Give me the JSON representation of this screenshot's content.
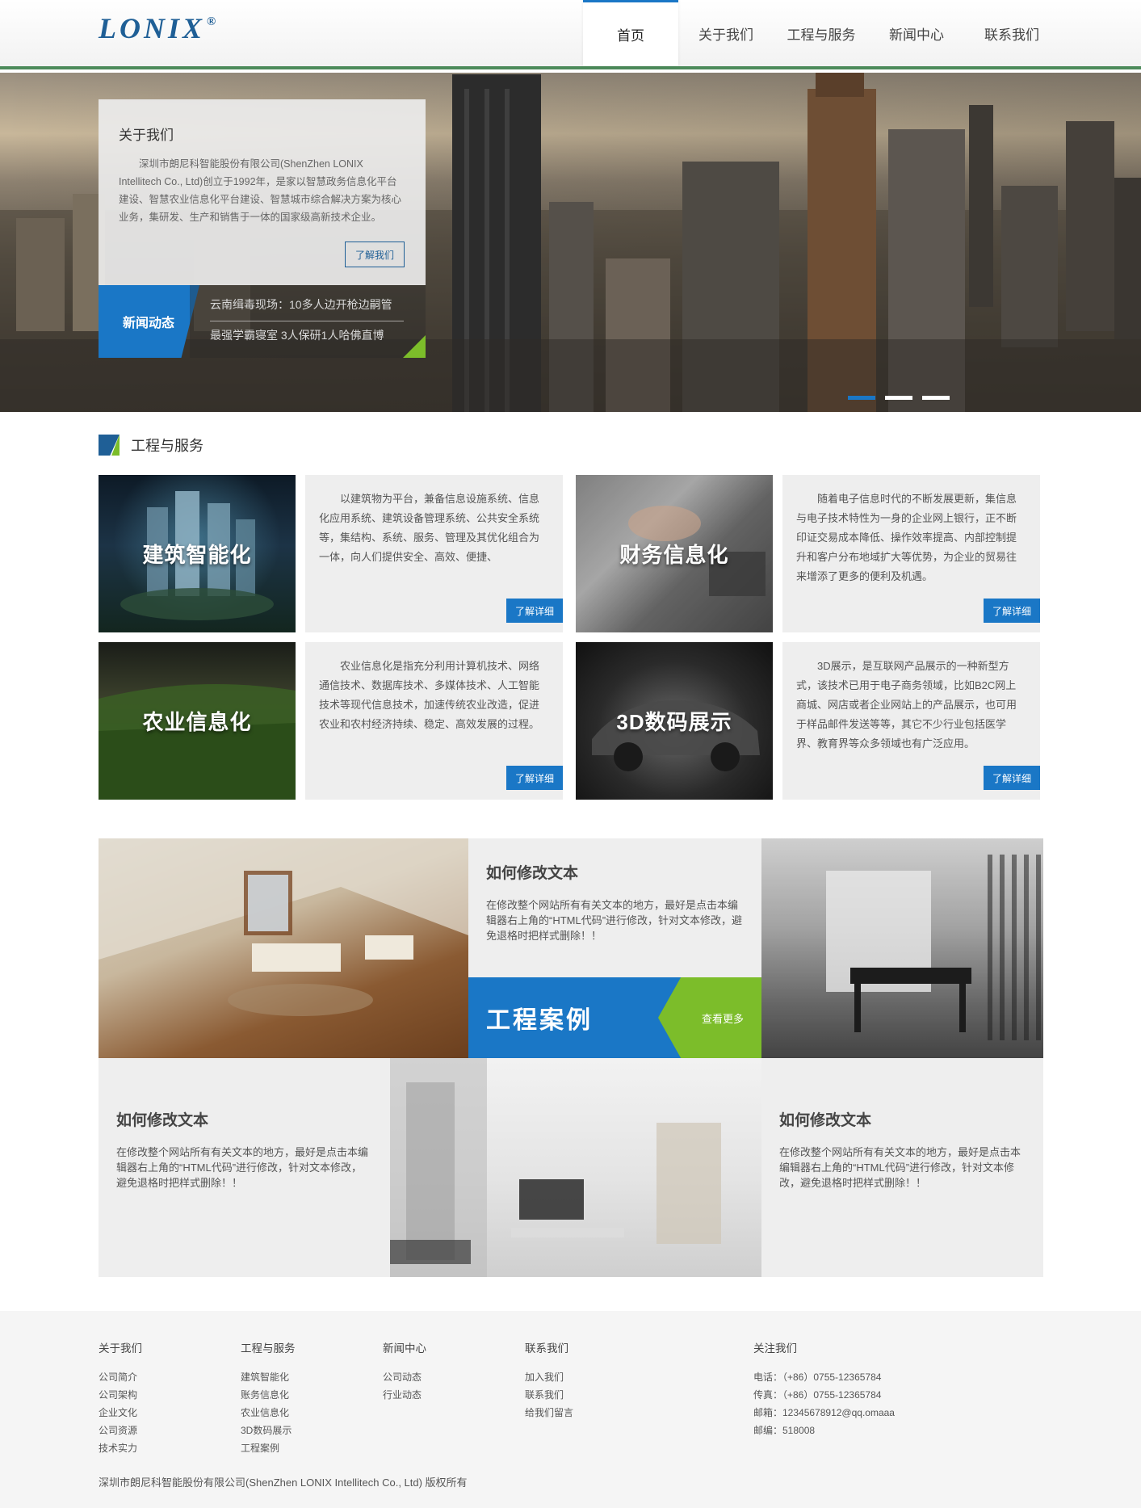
{
  "logo": {
    "text": "LONIX",
    "mark": "®"
  },
  "nav": {
    "items": [
      {
        "label": "首页",
        "active": true
      },
      {
        "label": "关于我们",
        "active": false
      },
      {
        "label": "工程与服务",
        "active": false
      },
      {
        "label": "新闻中心",
        "active": false
      },
      {
        "label": "联系我们",
        "active": false
      }
    ]
  },
  "hero": {
    "about": {
      "title": "关于我们",
      "text": "深圳市朗尼科智能股份有限公司(ShenZhen LONIX Intellitech Co., Ltd)创立于1992年，是家以智慧政务信息化平台建设、智慧农业信息化平台建设、智慧城市综合解决方案为核心业务，集研发、生产和销售于一体的国家级高新技术企业。",
      "button": "了解我们"
    },
    "news": {
      "label": "新闻动态",
      "items": [
        "云南缉毒现场：10多人边开枪边嗣管",
        "最强学霸寝室 3人保研1人哈佛直博"
      ]
    },
    "slides": 3,
    "active_slide": 0
  },
  "services": {
    "title": "工程与服务",
    "items": [
      {
        "caption": "建筑智能化",
        "text": "以建筑物为平台，兼备信息设施系统、信息化应用系统、建筑设备管理系统、公共安全系统等，集结构、系统、服务、管理及其优化组合为一体，向人们提供安全、高效、便捷、",
        "button": "了解详细"
      },
      {
        "caption": "财务信息化",
        "text": "随着电子信息时代的不断发展更新，集信息与电子技术特性为一身的企业网上银行，正不断印证交易成本降低、操作效率提高、内部控制提升和客户分布地域扩大等优势，为企业的贸易往来增添了更多的便利及机遇。",
        "button": "了解详细"
      },
      {
        "caption": "农业信息化",
        "text": "农业信息化是指充分利用计算机技术、网络通信技术、数据库技术、多媒体技术、人工智能技术等现代信息技术，加速传统农业改造，促进农业和农村经济持续、稳定、高效发展的过程。",
        "button": "了解详细"
      },
      {
        "caption": "3D数码展示",
        "text": "3D展示，是互联网产品展示的一种新型方式，该技术已用于电子商务领域，比如B2C网上商城、网店或者企业网站上的产品展示，也可用于样品邮件发送等等，其它不少行业包括医学界、教育界等众多领域也有广泛应用。",
        "button": "了解详细"
      }
    ]
  },
  "cases": {
    "band_title": "工程案例",
    "more": "查看更多",
    "blocks": [
      {
        "title": "如何修改文本",
        "text": "在修改整个网站所有有关文本的地方，最好是点击本编辑器右上角的“HTML代码”进行修改，针对文本修改，避免退格时把样式删除！！"
      },
      {
        "title": "如何修改文本",
        "text": "在修改整个网站所有有关文本的地方，最好是点击本编辑器右上角的“HTML代码”进行修改，针对文本修改，避免退格时把样式删除！！"
      },
      {
        "title": "如何修改文本",
        "text": "在修改整个网站所有有关文本的地方，最好是点击本编辑器右上角的“HTML代码”进行修改，针对文本修改，避免退格时把样式删除！！"
      }
    ]
  },
  "footer": {
    "columns": [
      {
        "title": "关于我们",
        "links": [
          "公司简介",
          "公司架构",
          "企业文化",
          "公司资源",
          "技术实力"
        ]
      },
      {
        "title": "工程与服务",
        "links": [
          "建筑智能化",
          "账务信息化",
          "农业信息化",
          "3D数码展示",
          "工程案例"
        ]
      },
      {
        "title": "新闻中心",
        "links": [
          "公司动态",
          "行业动态"
        ]
      },
      {
        "title": "联系我们",
        "links": [
          "加入我们",
          "联系我们",
          "给我们留言"
        ]
      }
    ],
    "follow": {
      "title": "关注我们",
      "lines": [
        "电话：（+86）0755-12365784",
        "传真：（+86）0755-12365784",
        "邮箱：12345678912@qq.omaaa",
        "邮编：518008"
      ]
    },
    "copyright": "深圳市朗尼科智能股份有限公司(ShenZhen LONIX Intellitech Co., Ltd) 版权所有"
  },
  "colors": {
    "brand_blue": "#1a77c6",
    "logo_blue": "#1f5f96",
    "accent_green": "#7cbd2a",
    "header_rule": "#4c8a5a"
  }
}
